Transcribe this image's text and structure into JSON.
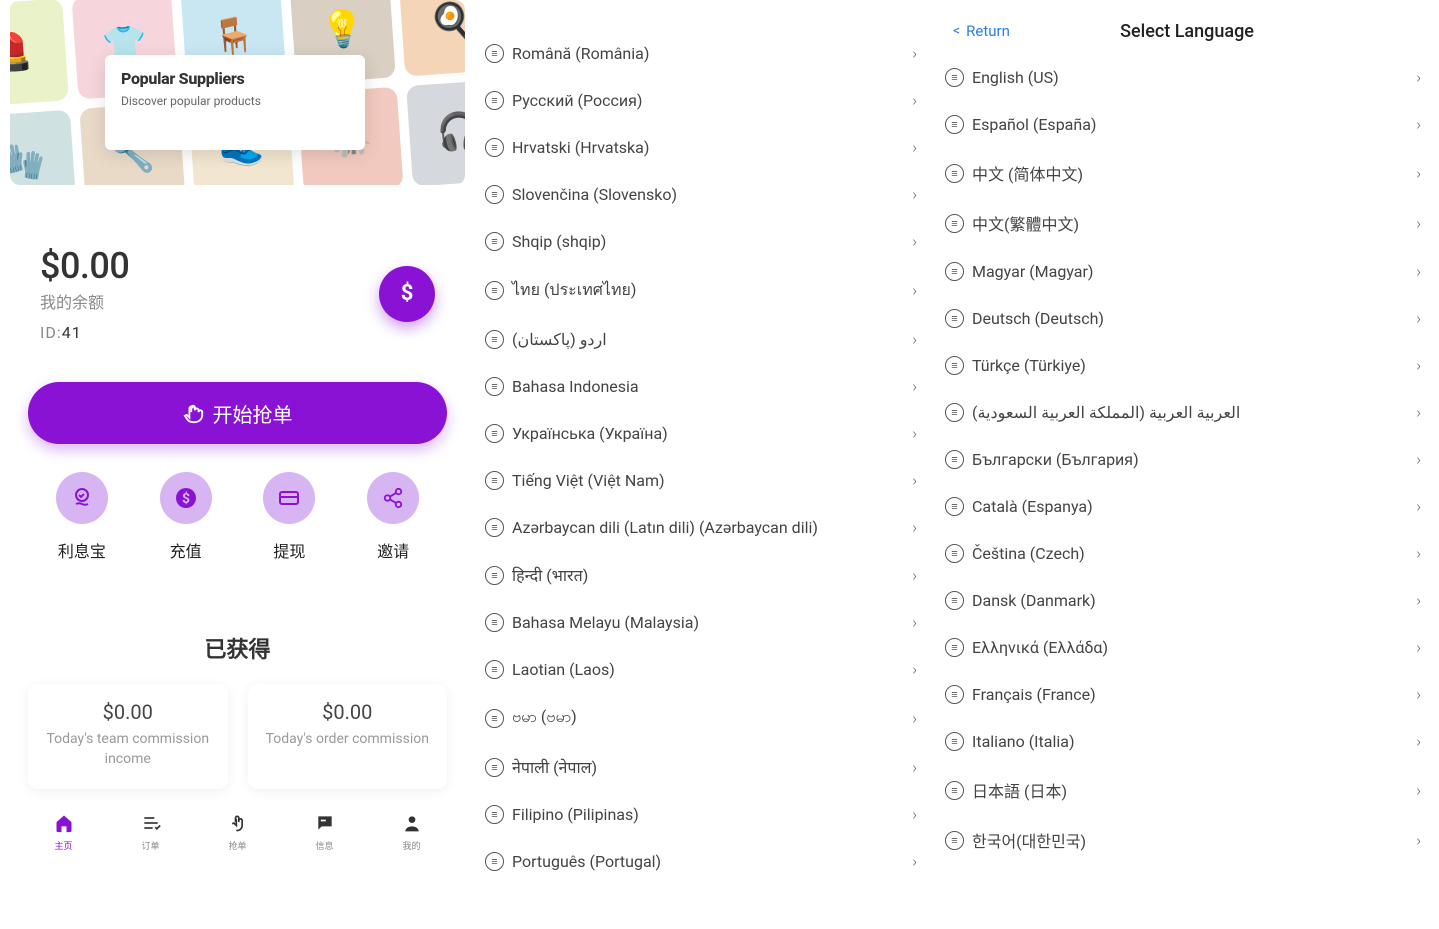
{
  "hero": {
    "title": "Popular Suppliers",
    "subtitle": "Discover popular products"
  },
  "balance": {
    "amount": "$0.00",
    "label": "我的余额",
    "id_prefix": "ID:",
    "id_value": "41"
  },
  "grab_button": "开始抢单",
  "actions": [
    {
      "label": "利息宝"
    },
    {
      "label": "充值"
    },
    {
      "label": "提现"
    },
    {
      "label": "邀请"
    }
  ],
  "gained_title": "已获得",
  "stats": [
    {
      "value": "$0.00",
      "label": "Today's team commission income"
    },
    {
      "value": "$0.00",
      "label": "Today's order commission"
    }
  ],
  "tabs": [
    {
      "label": "主页"
    },
    {
      "label": "订单"
    },
    {
      "label": "抢单"
    },
    {
      "label": "信息"
    },
    {
      "label": "我的"
    }
  ],
  "mid_languages": [
    "Română (România)",
    "Русский (Россия)",
    "Hrvatski (Hrvatska)",
    "Slovenčina (Slovensko)",
    "Shqip (shqip)",
    "ไทย (ประเทศไทย)",
    "اردو (پاکستان)",
    "Bahasa Indonesia",
    "Українська (Україна)",
    "Tiếng Việt (Việt Nam)",
    "Azərbaycan dili (Latın dili) (Azərbaycan dili)",
    "हिन्दी (भारत)",
    "Bahasa Melayu (Malaysia)",
    "Laotian (Laos)",
    "ဗမာ (ဗမာ)",
    "नेपाली (नेपाल)",
    "Filipino (Pilipinas)",
    "Português (Portugal)"
  ],
  "right_header": {
    "return": "Return",
    "title": "Select Language"
  },
  "right_languages": [
    "English (US)",
    "Español (España)",
    "中文 (简体中文)",
    "中文(繁體中文)",
    "Magyar (Magyar)",
    "Deutsch (Deutsch)",
    "Türkçe (Türkiye)",
    "العربية العربية (المملكة العربية السعودية)",
    "Български (България)",
    "Català (Espanya)",
    "Čeština (Czech)",
    "Dansk (Danmark)",
    "Ελληνικά (Ελλάδα)",
    "Français (France)",
    "Italiano (Italia)",
    "日本語 (日本)",
    "한국어(대한민국)"
  ]
}
